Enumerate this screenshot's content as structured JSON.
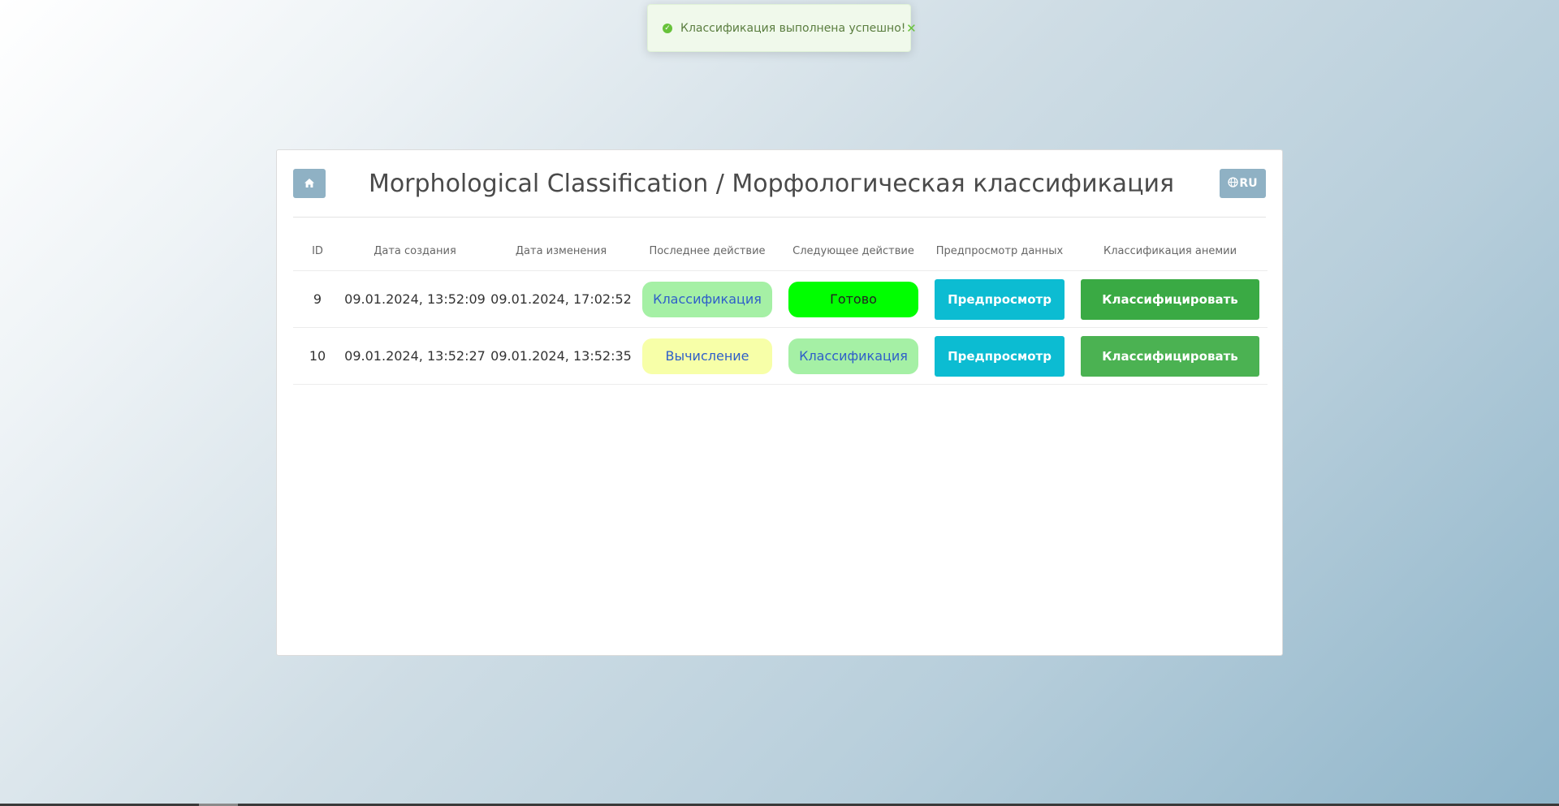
{
  "toast": {
    "message": "Классификация выполнена успешно!",
    "icon": "check-circle-icon",
    "close_icon": "close-icon"
  },
  "header": {
    "title": "Morphological Classification / Морфологическая классификация",
    "home_icon": "home-icon",
    "lang_label": "RU",
    "lang_icon": "globe-icon"
  },
  "table": {
    "columns": [
      "ID",
      "Дата создания",
      "Дата изменения",
      "Последнее действие",
      "Следующее действие",
      "Предпросмотр данных",
      "Классификация анемии"
    ],
    "rows": [
      {
        "id": "9",
        "created": "09.01.2024, 13:52:09",
        "modified": "09.01.2024, 17:02:52",
        "last_action": "Классификация",
        "next_action": "Готово",
        "preview": "Предпросмотр",
        "classify": "Классифицировать"
      },
      {
        "id": "10",
        "created": "09.01.2024, 13:52:27",
        "modified": "09.01.2024, 13:52:35",
        "last_action": "Вычисление",
        "next_action": "Классификация",
        "preview": "Предпросмотр",
        "classify": "Классифицировать"
      }
    ]
  },
  "colors": {
    "accent_button": "#8fb1c4",
    "preview_button": "#0cbcd2",
    "classify_button": "#3aaa44",
    "toast_bg": "#f0f9eb",
    "status_done": "#00ff00",
    "status_classification": "#a5f0a5",
    "status_computation": "#f7ffa8"
  }
}
